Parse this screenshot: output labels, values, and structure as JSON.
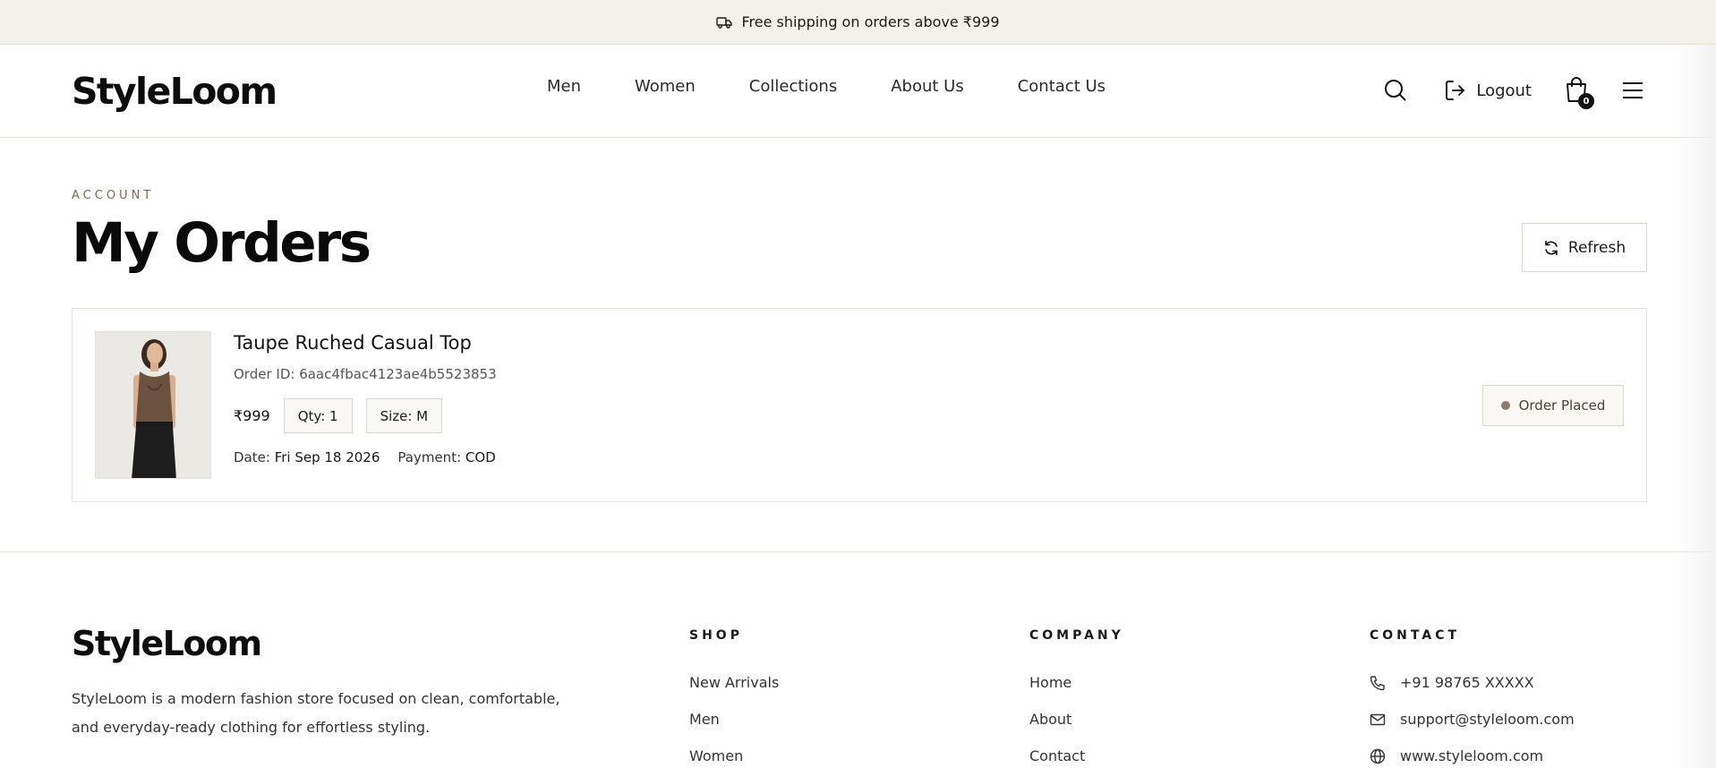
{
  "topbar": {
    "text": "Free shipping on orders above ₹999"
  },
  "header": {
    "logo": "StyleLoom",
    "nav": [
      "Men",
      "Women",
      "Collections",
      "About Us",
      "Contact Us"
    ],
    "logout_label": "Logout",
    "cart_count": "0"
  },
  "main": {
    "eyebrow": "ACCOUNT",
    "title": "My Orders",
    "refresh_label": "Refresh"
  },
  "order": {
    "product_name": "Taupe Ruched Casual Top",
    "order_id": "Order ID: 6aac4fbac4123ae4b5523853",
    "price": "₹999",
    "qty": "Qty: 1",
    "size": "Size: M",
    "date_label": "Date:",
    "date_value": "Fri Sep 18 2026",
    "payment_label": "Payment:",
    "payment_value": "COD",
    "status": "Order Placed"
  },
  "footer": {
    "logo": "StyleLoom",
    "about": "StyleLoom is a modern fashion store focused on clean, comfortable, and everyday-ready clothing for effortless styling.",
    "shop": {
      "title": "SHOP",
      "links": [
        "New Arrivals",
        "Men",
        "Women"
      ]
    },
    "company": {
      "title": "COMPANY",
      "links": [
        "Home",
        "About",
        "Contact"
      ]
    },
    "contact": {
      "title": "CONTACT",
      "phone": "+91 98765 XXXXX",
      "email": "support@styleloom.com",
      "website": "www.styleloom.com"
    }
  },
  "colors": {
    "topbar_bg": "#f4f0eb",
    "accent_brown": "#8e7b6b",
    "chip_bg": "#faf8f5",
    "border": "#e6e1da"
  }
}
